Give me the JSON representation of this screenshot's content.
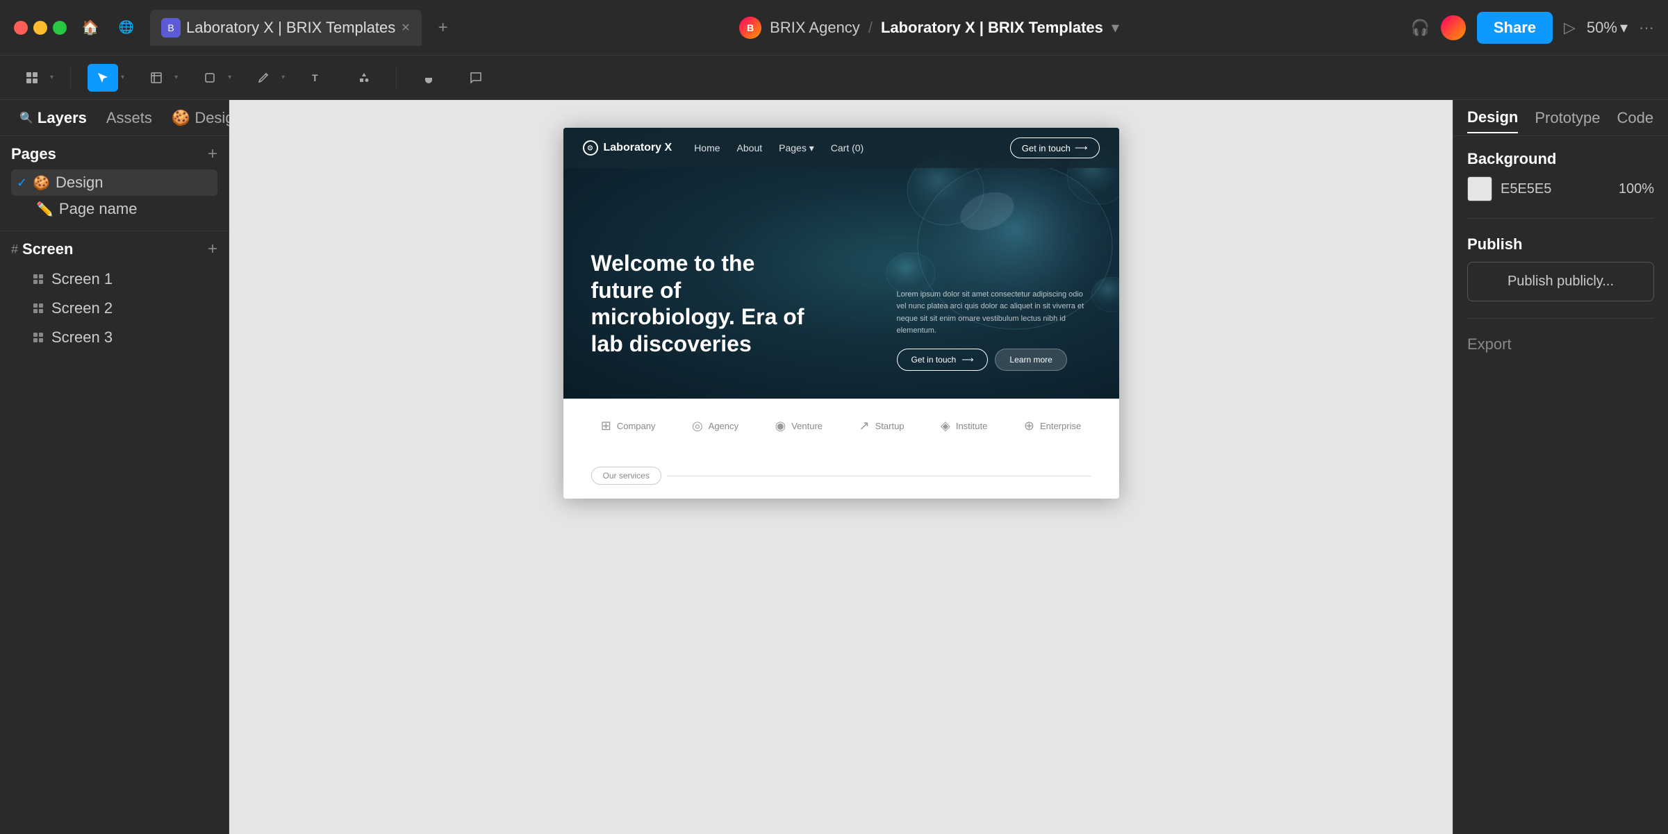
{
  "titlebar": {
    "tab_title": "Laboratory X | BRIX Templates",
    "tab_icon": "B",
    "breadcrumb_agency": "BRIX Agency",
    "breadcrumb_sep": "/",
    "breadcrumb_project": "Laboratory X | BRIX Templates",
    "share_label": "Share",
    "zoom_level": "50%"
  },
  "toolbar": {
    "tools": [
      "grid",
      "select",
      "frame",
      "shape",
      "pen",
      "text",
      "components",
      "hand",
      "comment"
    ]
  },
  "left_panel": {
    "tabs": [
      "Layers",
      "Assets"
    ],
    "design_tab": "Design",
    "pages_title": "Pages",
    "pages": [
      {
        "name": "Design",
        "active": true,
        "emoji": "🍪"
      },
      {
        "name": "Page name",
        "emoji": "✏️"
      }
    ],
    "screen_section": "Screen",
    "layers": [
      "Screen 1",
      "Screen 2",
      "Screen 3"
    ]
  },
  "canvas": {
    "background_color": "#E5E5E5"
  },
  "website": {
    "nav": {
      "logo": "Laboratory X",
      "links": [
        "Home",
        "About",
        "Pages",
        "Cart (0)"
      ],
      "cta": "Get in touch"
    },
    "hero": {
      "title": "Welcome to the future of microbiology. Era of lab discoveries",
      "description": "Lorem ipsum dolor sit amet consectetur adipiscing odio vel nunc platea arci quis dolor ac aliquet in sit viverra et neque sit sit enim ornare vestibulum lectus nibh id elementum.",
      "btn_primary": "Get in touch",
      "btn_secondary": "Learn more"
    },
    "partners": [
      {
        "name": "Company",
        "icon": "⊞"
      },
      {
        "name": "Agency",
        "icon": "◎"
      },
      {
        "name": "Venture",
        "icon": "◉"
      },
      {
        "name": "Startup",
        "icon": "↗"
      },
      {
        "name": "Institute",
        "icon": "◈"
      },
      {
        "name": "Enterprise",
        "icon": "⊕"
      }
    ],
    "services_badge": "Our services"
  },
  "right_panel": {
    "tabs": [
      "Design",
      "Prototype",
      "Code"
    ],
    "background_section": "Background",
    "bg_color": "E5E5E5",
    "bg_opacity": "100%",
    "publish_section": "Publish",
    "publish_label": "Publish publicly...",
    "export_section": "Export"
  }
}
